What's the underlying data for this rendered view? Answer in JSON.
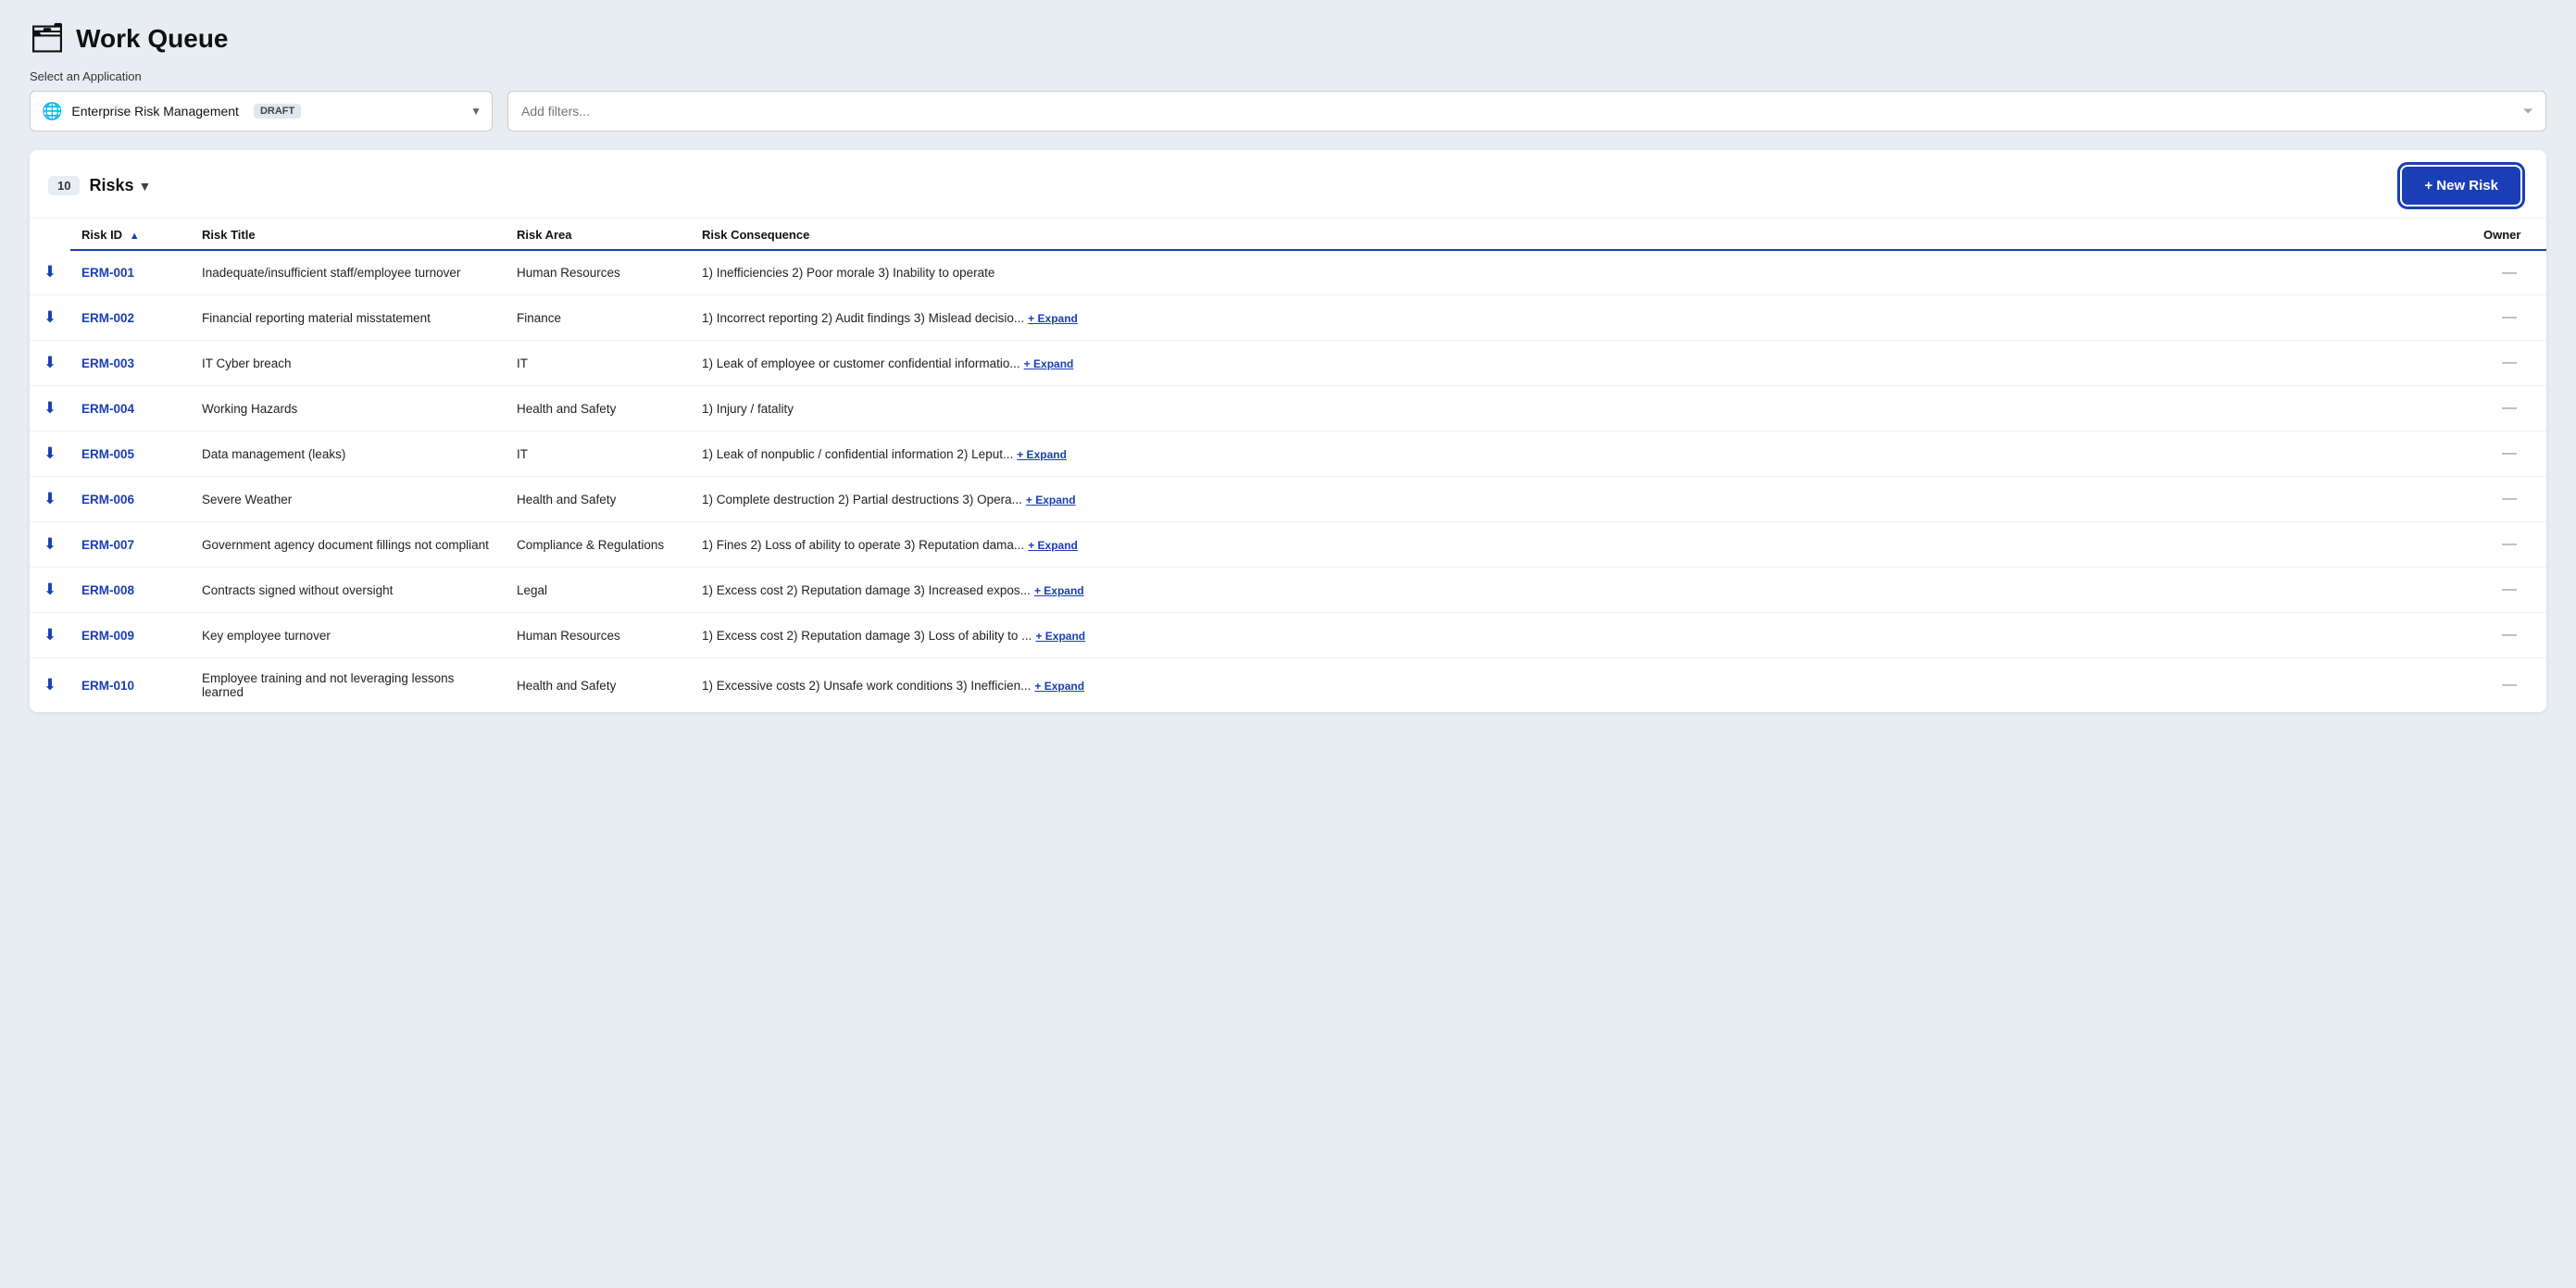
{
  "page": {
    "title": "Work Queue",
    "select_app_label": "Select an Application"
  },
  "app_selector": {
    "icon": "🔵",
    "name": "Enterprise Risk Management",
    "badge": "DRAFT",
    "chevron": "▼"
  },
  "filter": {
    "placeholder": "Add filters...",
    "filter_icon": "▼"
  },
  "risks_section": {
    "count": "10",
    "label": "Risks",
    "chevron": "▼",
    "new_risk_label": "+ New Risk"
  },
  "table": {
    "columns": [
      {
        "key": "icon",
        "label": ""
      },
      {
        "key": "id",
        "label": "Risk ID",
        "sortable": true
      },
      {
        "key": "title",
        "label": "Risk Title"
      },
      {
        "key": "area",
        "label": "Risk Area"
      },
      {
        "key": "consequence",
        "label": "Risk Consequence"
      },
      {
        "key": "owner",
        "label": "Owner"
      }
    ],
    "rows": [
      {
        "id": "ERM-001",
        "title": "Inadequate/insufficient staff/employee turnover",
        "area": "Human Resources",
        "consequence": "1) Inefficiencies 2) Poor morale 3) Inability to operate",
        "consequence_truncated": false,
        "owner": "—"
      },
      {
        "id": "ERM-002",
        "title": "Financial reporting material misstatement",
        "area": "Finance",
        "consequence": "1) Incorrect reporting 2) Audit findings 3) Mislead decisio...",
        "consequence_truncated": true,
        "owner": "—"
      },
      {
        "id": "ERM-003",
        "title": "IT Cyber breach",
        "area": "IT",
        "consequence": "1) Leak of employee or customer confidential informatio...",
        "consequence_truncated": true,
        "owner": "—"
      },
      {
        "id": "ERM-004",
        "title": "Working Hazards",
        "area": "Health and Safety",
        "consequence": "1) Injury / fatality",
        "consequence_truncated": false,
        "owner": "—"
      },
      {
        "id": "ERM-005",
        "title": "Data management (leaks)",
        "area": "IT",
        "consequence": "1) Leak of nonpublic / confidential information 2) Leput...",
        "consequence_truncated": true,
        "owner": "—"
      },
      {
        "id": "ERM-006",
        "title": "Severe Weather",
        "area": "Health and Safety",
        "consequence": "1) Complete destruction 2) Partial destructions 3) Opera...",
        "consequence_truncated": true,
        "owner": "—"
      },
      {
        "id": "ERM-007",
        "title": "Government agency document fillings not compliant",
        "area": "Compliance & Regulations",
        "consequence": "1) Fines 2) Loss of ability to operate 3) Reputation dama...",
        "consequence_truncated": true,
        "owner": "—"
      },
      {
        "id": "ERM-008",
        "title": "Contracts signed without oversight",
        "area": "Legal",
        "consequence": "1) Excess cost 2) Reputation damage 3) Increased expos...",
        "consequence_truncated": true,
        "owner": "—"
      },
      {
        "id": "ERM-009",
        "title": "Key employee turnover",
        "area": "Human Resources",
        "consequence": "1) Excess cost 2) Reputation damage 3) Loss of ability to ...",
        "consequence_truncated": true,
        "owner": "—"
      },
      {
        "id": "ERM-010",
        "title": "Employee training and not leveraging lessons learned",
        "area": "Health and Safety",
        "consequence": "1) Excessive costs 2) Unsafe work conditions 3) Inefficien...",
        "consequence_truncated": true,
        "owner": "—"
      }
    ]
  }
}
